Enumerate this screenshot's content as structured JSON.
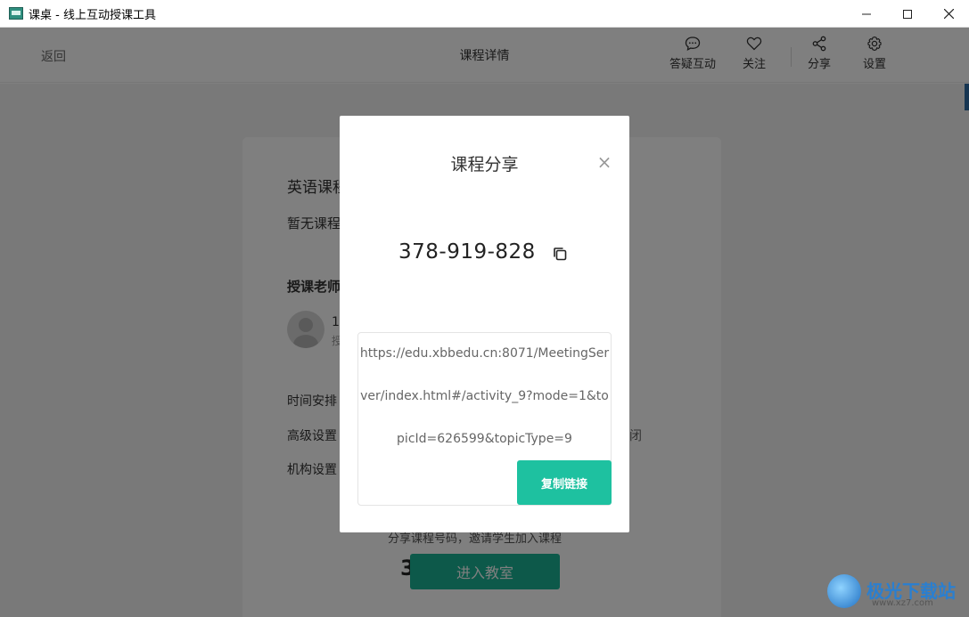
{
  "window": {
    "title": "课桌 - 线上互动授课工具",
    "controls": {
      "minimize": "—",
      "maximize": "☐",
      "close": "✕"
    }
  },
  "header": {
    "back_label": "返回",
    "page_title": "课程详情",
    "actions": [
      {
        "label": "答疑互动",
        "icon": "chat-bubble-icon"
      },
      {
        "label": "关注",
        "icon": "heart-icon"
      },
      {
        "label": "分享",
        "icon": "share-icon"
      },
      {
        "label": "设置",
        "icon": "gear-icon"
      }
    ]
  },
  "course": {
    "name_partial": "英语课程",
    "desc_partial": "暂无课程",
    "teacher_heading_partial": "授课老师",
    "teacher_name_partial": "1",
    "teacher_role_partial": "授",
    "schedule_label": "时间安排",
    "advanced_label": "高级设置",
    "advanced_value_partial": "闭",
    "org_label": "机构设置",
    "share_hint": "分享课程号码，邀请学生加入课程",
    "code_partial": "3",
    "enter_button": "进入教室"
  },
  "share_modal": {
    "title": "课程分享",
    "close_symbol": "×",
    "course_code": "378-919-828",
    "link_lines": [
      "https://edu.xbbedu.cn:8071/MeetingSer",
      "ver/index.html#/activity_9?mode=1&to",
      "picId=626599&topicType=9"
    ],
    "copy_link_button": "复制链接"
  },
  "watermark": {
    "text": "极光下载站",
    "sub": "www.xz7.com"
  },
  "colors": {
    "accent": "#1ec1a0",
    "accent_dark": "#1ab394",
    "overlay": "rgba(0,0,0,0.5)"
  }
}
